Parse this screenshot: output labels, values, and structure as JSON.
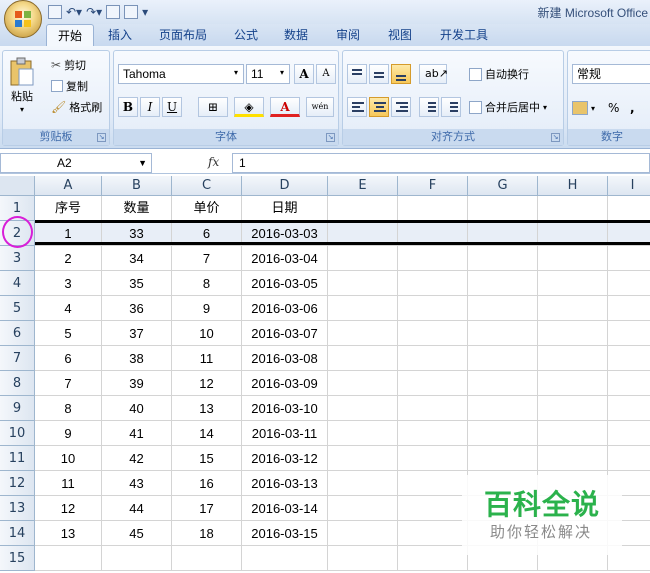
{
  "app": {
    "title": "新建 Microsoft Office"
  },
  "ribbon_tabs": [
    "开始",
    "插入",
    "页面布局",
    "公式",
    "数据",
    "审阅",
    "视图",
    "开发工具"
  ],
  "clipboard": {
    "paste_label": "粘贴",
    "cut_label": "剪切",
    "copy_label": "复制",
    "format_painter_label": "格式刷",
    "group_label": "剪贴板"
  },
  "font": {
    "name": "Tahoma",
    "size": "11",
    "group_label": "字体",
    "bold": "B",
    "italic": "I",
    "underline": "U",
    "grow": "A",
    "shrink": "A",
    "phonetic": "wén"
  },
  "alignment": {
    "wrap_label": "自动换行",
    "merge_label": "合并后居中",
    "group_label": "对齐方式"
  },
  "number": {
    "format": "常规",
    "percent": "%",
    "comma": ",",
    "group_label": "数字"
  },
  "formula_bar": {
    "name_box": "A2",
    "fx": "fx",
    "value": "1"
  },
  "columns": [
    "A",
    "B",
    "C",
    "D",
    "E",
    "F",
    "G",
    "H",
    "I"
  ],
  "rows": [
    "1",
    "2",
    "3",
    "4",
    "5",
    "6",
    "7",
    "8",
    "9",
    "10",
    "11",
    "12",
    "13",
    "14",
    "15"
  ],
  "table": {
    "headers": [
      "序号",
      "数量",
      "单价",
      "日期"
    ],
    "data": [
      [
        "1",
        "33",
        "6",
        "2016-03-03"
      ],
      [
        "2",
        "34",
        "7",
        "2016-03-04"
      ],
      [
        "3",
        "35",
        "8",
        "2016-03-05"
      ],
      [
        "4",
        "36",
        "9",
        "2016-03-06"
      ],
      [
        "5",
        "37",
        "10",
        "2016-03-07"
      ],
      [
        "6",
        "38",
        "11",
        "2016-03-08"
      ],
      [
        "7",
        "39",
        "12",
        "2016-03-09"
      ],
      [
        "8",
        "40",
        "13",
        "2016-03-10"
      ],
      [
        "9",
        "41",
        "14",
        "2016-03-11"
      ],
      [
        "10",
        "42",
        "15",
        "2016-03-12"
      ],
      [
        "11",
        "43",
        "16",
        "2016-03-13"
      ],
      [
        "12",
        "44",
        "17",
        "2016-03-14"
      ],
      [
        "13",
        "45",
        "18",
        "2016-03-15"
      ]
    ]
  },
  "watermark": {
    "title": "百科全说",
    "subtitle": "助你轻松解决"
  },
  "colors": {
    "selection_circle": "#d81fd8",
    "watermark_green": "#2bb24c"
  }
}
